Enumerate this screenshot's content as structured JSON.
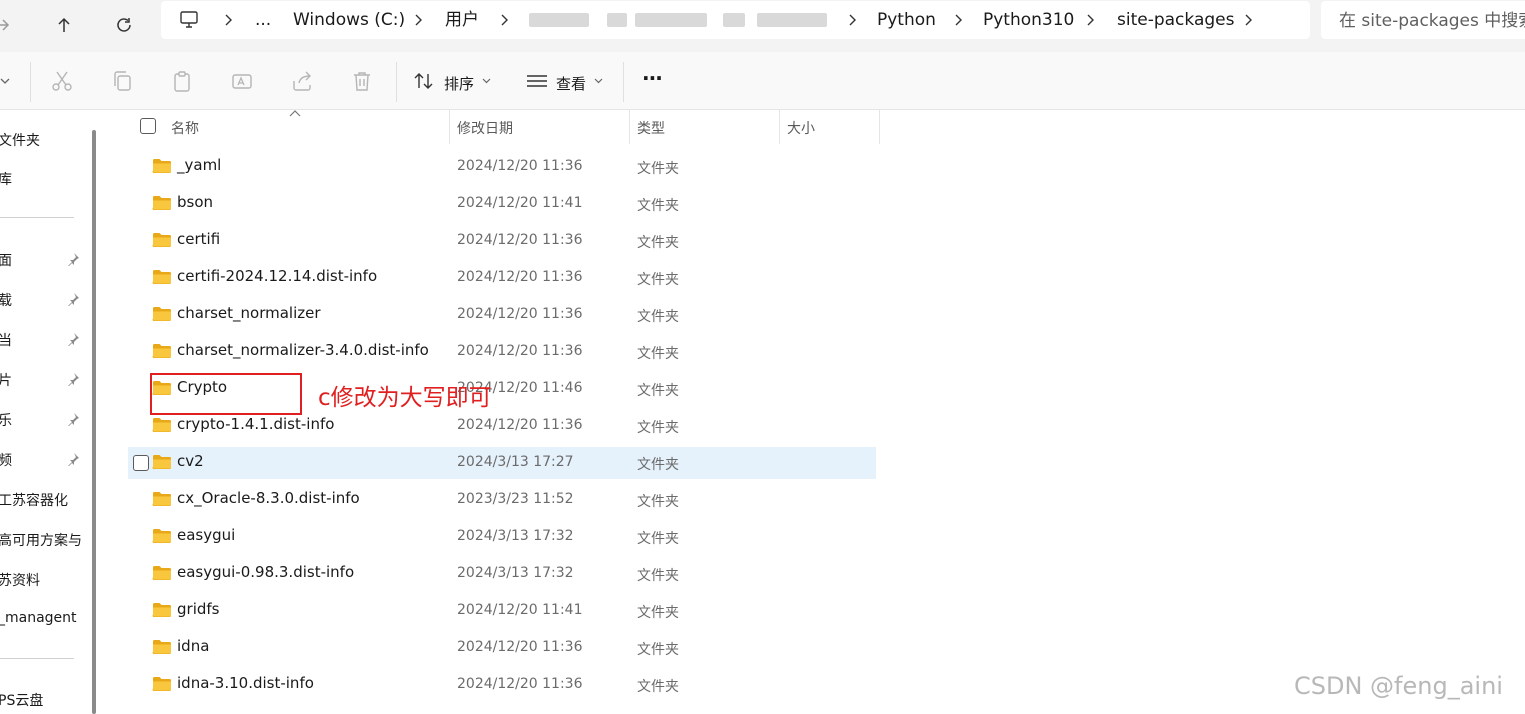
{
  "address_bar": {
    "crumbs": [
      "...",
      "Windows (C:)",
      "用户",
      "Python",
      "Python310",
      "site-packages"
    ]
  },
  "search": {
    "placeholder": "在 site-packages 中搜索"
  },
  "toolbar": {
    "sort_label": "排序",
    "view_label": "查看",
    "more_label": "···"
  },
  "sidebar": {
    "items": [
      {
        "label": "文件夹",
        "pinned": false
      },
      {
        "label": "库",
        "pinned": false
      },
      {
        "label": "面",
        "pinned": true
      },
      {
        "label": "载",
        "pinned": true
      },
      {
        "label": "当",
        "pinned": true
      },
      {
        "label": "片",
        "pinned": true
      },
      {
        "label": "乐",
        "pinned": true
      },
      {
        "label": "频",
        "pinned": true
      },
      {
        "label": "工苏容器化",
        "pinned": false
      },
      {
        "label": "高可用方案与",
        "pinned": false
      },
      {
        "label": "苏资料",
        "pinned": false
      },
      {
        "label": "_managent",
        "pinned": false
      },
      {
        "label": "PS云盘",
        "pinned": false
      }
    ]
  },
  "columns": {
    "name": "名称",
    "modified": "修改日期",
    "type": "类型",
    "size": "大小"
  },
  "files": [
    {
      "name": "_yaml",
      "modified": "2024/12/20 11:36",
      "type": "文件夹"
    },
    {
      "name": "bson",
      "modified": "2024/12/20 11:41",
      "type": "文件夹"
    },
    {
      "name": "certifi",
      "modified": "2024/12/20 11:36",
      "type": "文件夹"
    },
    {
      "name": "certifi-2024.12.14.dist-info",
      "modified": "2024/12/20 11:36",
      "type": "文件夹"
    },
    {
      "name": "charset_normalizer",
      "modified": "2024/12/20 11:36",
      "type": "文件夹"
    },
    {
      "name": "charset_normalizer-3.4.0.dist-info",
      "modified": "2024/12/20 11:36",
      "type": "文件夹"
    },
    {
      "name": "Crypto",
      "modified": "2024/12/20 11:46",
      "type": "文件夹"
    },
    {
      "name": "crypto-1.4.1.dist-info",
      "modified": "2024/12/20 11:36",
      "type": "文件夹"
    },
    {
      "name": "cv2",
      "modified": "2024/3/13 17:27",
      "type": "文件夹"
    },
    {
      "name": "cx_Oracle-8.3.0.dist-info",
      "modified": "2023/3/23 11:52",
      "type": "文件夹"
    },
    {
      "name": "easygui",
      "modified": "2024/3/13 17:32",
      "type": "文件夹"
    },
    {
      "name": "easygui-0.98.3.dist-info",
      "modified": "2024/3/13 17:32",
      "type": "文件夹"
    },
    {
      "name": "gridfs",
      "modified": "2024/12/20 11:41",
      "type": "文件夹"
    },
    {
      "name": "idna",
      "modified": "2024/12/20 11:36",
      "type": "文件夹"
    },
    {
      "name": "idna-3.10.dist-info",
      "modified": "2024/12/20 11:36",
      "type": "文件夹"
    }
  ],
  "annotation": {
    "text": "c修改为大写即可"
  },
  "watermark": "CSDN @feng_aini",
  "colors": {
    "accent": "#0067c0",
    "hover_row": "#e5f1fb",
    "annotation": "#e02020",
    "folder": "#f8c73e"
  }
}
